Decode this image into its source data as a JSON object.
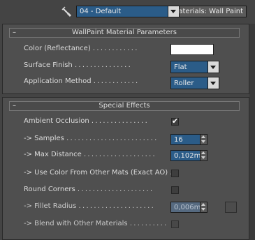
{
  "toolbar": {
    "material_name": "04 - Default",
    "material_type": "aterials: Wall Paint"
  },
  "rollouts": [
    {
      "toggle": "–",
      "title": "WallPaint Material Parameters",
      "rows": [
        {
          "label": "Color (Reflectance)",
          "dots": "............",
          "swatch_color": "#ffffff"
        },
        {
          "label": "Surface Finish",
          "dots": "...............",
          "value": "Flat"
        },
        {
          "label": "Application Method",
          "dots": "............",
          "value": "Roller"
        }
      ]
    },
    {
      "toggle": "–",
      "title": "Special Effects",
      "rows": [
        {
          "label": "Ambient Occlusion",
          "dots": "...............",
          "checked": true
        },
        {
          "label": "-> Samples",
          "dots": "........................",
          "value": "16"
        },
        {
          "label": "-> Max Distance",
          "dots": "...................",
          "value": "0,102m"
        },
        {
          "label": "-> Use Color From Other Mats (Exact AO)",
          "dots": "..",
          "checked": false
        },
        {
          "label": "Round Corners",
          "dots": "....................",
          "checked": false
        },
        {
          "label": "-> Fillet Radius",
          "dots": "....................",
          "value": "0,006m",
          "enabled": false
        },
        {
          "label": "-> Blend with Other Materials",
          "dots": "..........",
          "checked": false,
          "enabled": false
        }
      ]
    }
  ],
  "colors": {
    "background": "#444444",
    "panel": "#4f4f4f",
    "field_blue": "#2b5c88",
    "swatch": "#ffffff"
  }
}
